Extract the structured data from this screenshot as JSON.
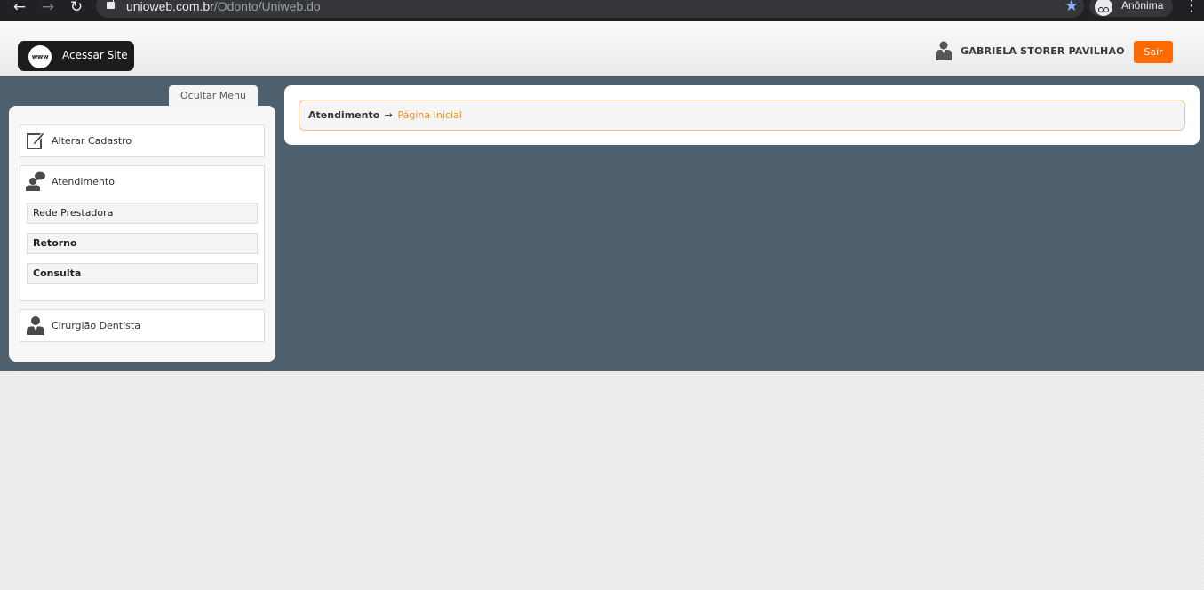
{
  "browser": {
    "url_host": "unioweb.com.br",
    "url_path": "/Odonto/Uniweb.do",
    "profile_label": "Anônima"
  },
  "header": {
    "site_button_label": "Acessar Site",
    "site_button_icon_text": "www",
    "user_name": "GABRIELA STORER PAVILHAO",
    "logout_label": "Sair",
    "accent_color": "#ff6a00"
  },
  "sidebar": {
    "toggle_label": "Ocultar Menu",
    "items": [
      {
        "label": "Alterar Cadastro",
        "icon": "edit-icon"
      },
      {
        "label": "Atendimento",
        "icon": "support-person-icon",
        "children": [
          "Rede Prestadora",
          "Retorno",
          "Consulta"
        ]
      },
      {
        "label": "Cirurgião Dentista",
        "icon": "dentist-icon"
      }
    ]
  },
  "breadcrumb": {
    "root": "Atendimento",
    "separator": "→",
    "current": "Página Inicial"
  },
  "colors": {
    "main_background": "#4e606e",
    "breadcrumb_link": "#f5911e"
  }
}
